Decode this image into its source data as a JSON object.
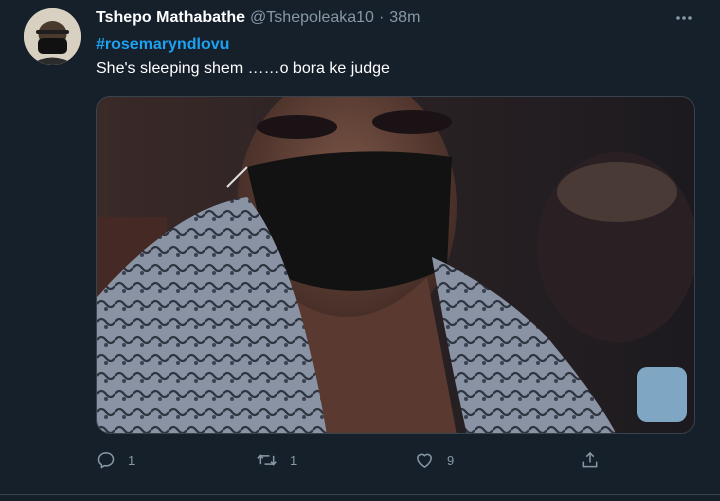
{
  "tweet": {
    "author": {
      "display_name": "Tshepo Mathabathe",
      "handle": "@Tshepoleaka10",
      "separator": "·",
      "time": "38m"
    },
    "hashtag": "#rosemaryndlovu",
    "text": "She's sleeping shem ……o bora ke judge",
    "actions": {
      "reply_count": "1",
      "retweet_count": "1",
      "like_count": "9"
    }
  },
  "colors": {
    "background": "#15202b",
    "text_primary": "#ffffff",
    "text_secondary": "#8899a6",
    "link": "#1da1f2",
    "border": "#38444d"
  },
  "icons": [
    "more-icon",
    "reply-icon",
    "retweet-icon",
    "like-icon",
    "share-icon"
  ]
}
